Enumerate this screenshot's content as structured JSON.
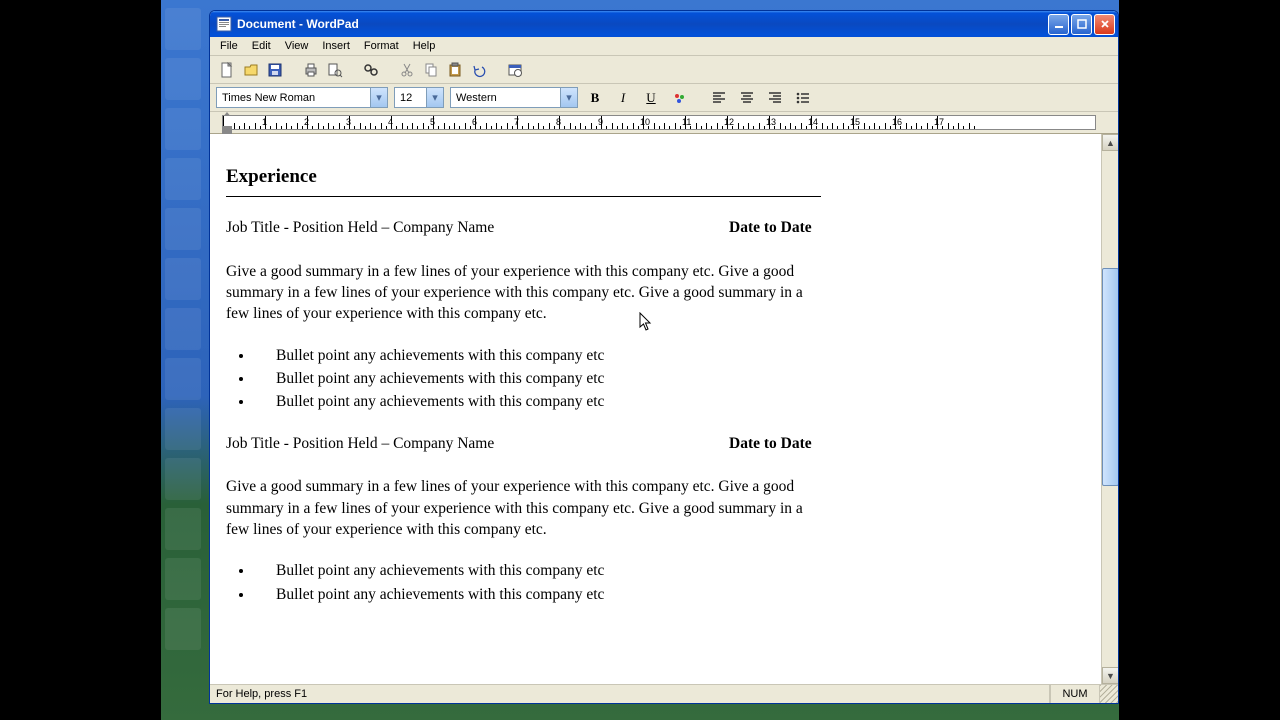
{
  "window": {
    "title": "Document - WordPad"
  },
  "menu": {
    "file": "File",
    "edit": "Edit",
    "view": "View",
    "insert": "Insert",
    "format": "Format",
    "help": "Help"
  },
  "format": {
    "font": "Times New Roman",
    "size": "12",
    "charset": "Western"
  },
  "ruler": {
    "marks": [
      1,
      2,
      3,
      4,
      5,
      6,
      7,
      8,
      9,
      10,
      11,
      12,
      13,
      14,
      15,
      16,
      17
    ]
  },
  "doc": {
    "heading": "Experience",
    "entries": [
      {
        "title": "Job Title - Position Held – Company Name",
        "dates": "Date to Date",
        "summary": "Give a good summary in a few lines of your experience with this company etc.  Give a good summary in a few lines of your experience with this company etc. Give a good summary in a few lines of your experience with this company etc.",
        "bullets": [
          "Bullet point any achievements with this company etc",
          "Bullet point any achievements with this company etc",
          "Bullet point any achievements with this company etc"
        ]
      },
      {
        "title": "Job Title - Position Held – Company Name",
        "dates": "Date to Date",
        "summary": "Give a good summary in a few lines of your experience with this company etc.  Give a good summary in a few lines of your experience with this company etc. Give a good summary in a few lines of your experience with this company etc.",
        "bullets": [
          "Bullet point any achievements with this company etc",
          "Bullet point any achievements with this company etc"
        ]
      }
    ]
  },
  "status": {
    "help": "For Help, press F1",
    "num": "NUM"
  }
}
